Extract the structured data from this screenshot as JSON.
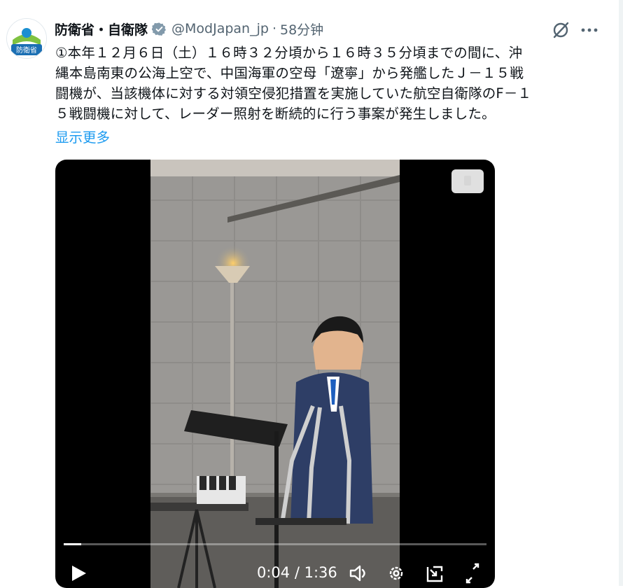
{
  "author": {
    "display_name": "防衛省・自衛隊",
    "handle": "@ModJapan_jp",
    "separator": "·",
    "time": "58分钟",
    "avatar_label": "防衛省"
  },
  "tweet": {
    "lines": [
      "①本年１２月６日（土）１６時３２分頃から１６時３５分頃までの間に、沖",
      "縄本島南東の公海上空で、中国海軍の空母「遼寧」から発艦したＪ－１５戦",
      "闘機が、当該機体に対する対領空侵犯措置を実施していた航空自衛隊のF－１",
      "５戦闘機に対して、レーダー照射を断続的に行う事案が発生しました。"
    ],
    "show_more": "显示更多"
  },
  "video": {
    "current_time": "0:04",
    "duration": "1:36",
    "progress": 0.042
  },
  "colors": {
    "accent": "#1d9bf0",
    "verified_gray": "#829aab",
    "text": "#0f1419",
    "muted": "#536471"
  },
  "icons": [
    "grok-icon",
    "more-icon",
    "verified-icon",
    "play-icon",
    "volume-icon",
    "settings-icon",
    "pip-icon",
    "fullscreen-icon"
  ]
}
